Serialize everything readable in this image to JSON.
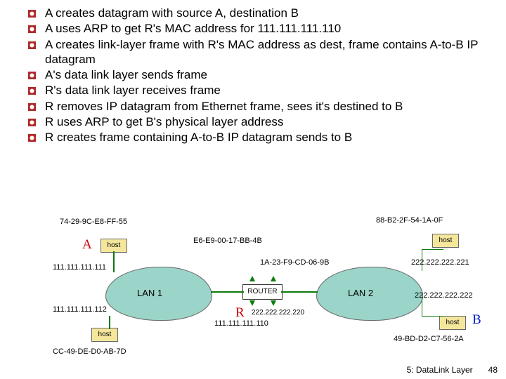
{
  "bullets": [
    "A creates datagram with source A, destination B",
    "A uses ARP to get R's MAC address for 111.111.111.110",
    "A creates link-layer frame with R's MAC address as dest, frame contains A-to-B IP datagram",
    "A's data link layer sends frame",
    "R's data link layer receives frame",
    "R removes IP datagram from Ethernet frame, sees it's destined to B",
    "R uses ARP to get B's physical layer address",
    "R creates frame containing A-to-B IP datagram sends to B"
  ],
  "diagram": {
    "hostA_mac": "74-29-9C-E8-FF-55",
    "hostA_ip": "111.111.111.111",
    "hostA_label": "A",
    "lan1_label": "LAN 1",
    "lan2_label": "LAN 2",
    "host2_ip": "111.111.111.112",
    "host2_mac": "CC-49-DE-D0-AB-7D",
    "router_label": "ROUTER",
    "router_left_mac": "E6-E9-00-17-BB-4B",
    "router_left_ip": "111.111.111.110",
    "router_right_mac": "1A-23-F9-CD-06-9B",
    "router_R_label": "R",
    "hostB_mac": "88-B2-2F-54-1A-0F",
    "hostB_ip": "222.222.222.221",
    "hostB_topRight": "host",
    "host4_ip": "222.222.222.222",
    "host4_mac": "49-BD-D2-C7-56-2A",
    "hostB_label": "B",
    "host_word": "host"
  },
  "footer": {
    "chapter": "5: DataLink Layer",
    "page": "48"
  }
}
